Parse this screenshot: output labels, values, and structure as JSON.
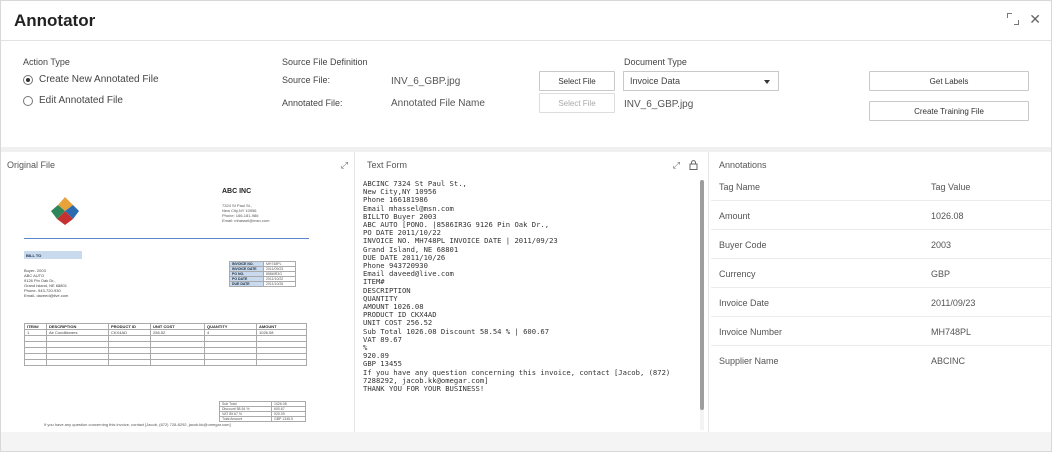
{
  "window": {
    "title": "Annotator"
  },
  "action": {
    "label": "Action Type",
    "options": [
      {
        "label": "Create New Annotated File",
        "selected": true
      },
      {
        "label": "Edit Annotated File",
        "selected": false
      }
    ]
  },
  "source": {
    "label": "Source File Definition",
    "source_file_label": "Source File:",
    "source_file_value": "INV_6_GBP.jpg",
    "select_file_label": "Select File",
    "annotated_file_label": "Annotated File:",
    "annotated_file_placeholder": "Annotated File Name",
    "select_file_label_2": "Select File"
  },
  "doctype": {
    "label": "Document Type",
    "selected": "Invoice Data",
    "file_value": "INV_6_GBP.jpg"
  },
  "buttons": {
    "get_labels": "Get Labels",
    "create_training": "Create Training File"
  },
  "original": {
    "title": "Original File",
    "doc": {
      "company": "ABC INC",
      "address": "7324 St Paul St.,\nNew City,NY 10956\nPhone: 166-181-986\nEmail: mhassel@msn.com",
      "bill_to": "BILL TO",
      "buyer": "Buyer- 2003\nABC AUTO\n9126 Pin Oak Dr.,\nGrand Island, NE 68801\nPhone- 943-720-930\nEmail- daveed@live.com",
      "inv_rows": [
        [
          "INVOICE NO.",
          "MH748PL"
        ],
        [
          "INVOICE DATE",
          "2011/09/23"
        ],
        [
          "PO NO.",
          "8586IR3G"
        ],
        [
          "PO DATE",
          "2011/10/22"
        ],
        [
          "DUE DATE",
          "2011/10/26"
        ]
      ],
      "items_header": [
        "ITEM#",
        "DESCRIPTION",
        "PRODUCT ID",
        "UNIT COST",
        "QUANTITY",
        "AMOUNT"
      ],
      "items_row": [
        "1",
        "Air Conditioners",
        "CKX4AD",
        "256.52",
        "4",
        "1026.08"
      ],
      "totals": [
        [
          "Sub Total",
          "1026.08"
        ],
        [
          "Discount  58.54 %",
          "600.67"
        ],
        [
          "VAT  89.67  %",
          "920.09"
        ],
        [
          "Total Amount",
          "GBP  1345.5"
        ]
      ],
      "footer": "If you have any question concerning this invoice, contact [Jacob, (872) 728-8292, jacob.kk@omegar.com]"
    }
  },
  "textform": {
    "title": "Text Form",
    "content": "ABCINC 7324 St Paul St.,\nNew City,NY 10956\nPhone 166181986\nEmail mhassel@msn.com\nBILLTO Buyer 2003\nABC AUTO [PONO. |8586IR3G 9126 Pin Oak Dr.,\nPO DATE 2011/10/22\nINVOICE NO. MH748PL INVOICE DATE | 2011/09/23\nGrand Island, NE 68801\nDUE DATE 2011/10/26\nPhone 943720930\nEmail daveed@live.com\nITEM#\nDESCRIPTION\nQUANTITY\nAMOUNT 1026.08\nPRODUCT ID CKX4AD\nUNIT COST 256.52\nSub Total 1026.08 Discount 58.54 % | 600.67\nVAT 89.67\n%\n920.09\nGBP 13455\nIf you have any question concerning this invoice, contact [Jacob, (872)\n7288292, jacob.kk@omegar.com]\nTHANK YOU FOR YOUR BUSINESS!"
  },
  "annotations": {
    "title": "Annotations",
    "col_name": "Tag Name",
    "col_value": "Tag Value",
    "rows": [
      {
        "name": "Amount",
        "value": "1026.08"
      },
      {
        "name": "Buyer Code",
        "value": "2003"
      },
      {
        "name": "Currency",
        "value": "GBP"
      },
      {
        "name": "Invoice Date",
        "value": "2011/09/23"
      },
      {
        "name": "Invoice Number",
        "value": "MH748PL"
      },
      {
        "name": "Supplier Name",
        "value": "ABCINC"
      }
    ]
  },
  "icons": {
    "expand": "expand-icon",
    "close": "close-icon",
    "lock": "lock-icon",
    "logo": "puzzle-logo"
  }
}
